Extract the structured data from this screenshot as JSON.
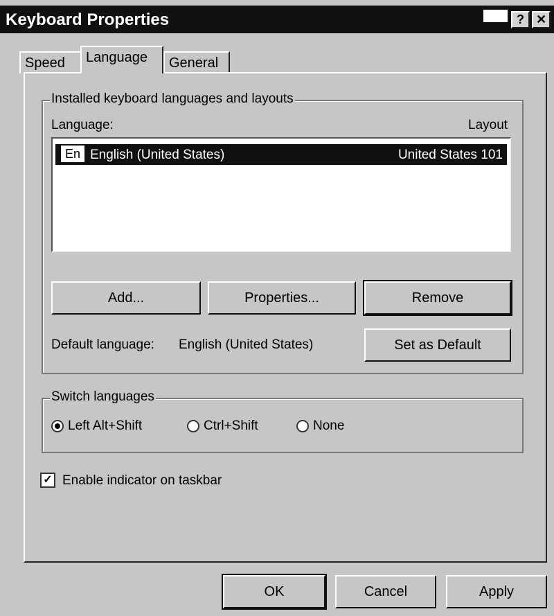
{
  "window": {
    "title": "Keyboard Properties"
  },
  "titlebar": {
    "help_label": "?",
    "close_label": "✕"
  },
  "tabs": [
    {
      "label": "Speed"
    },
    {
      "label": "Language"
    },
    {
      "label": "General"
    }
  ],
  "installed": {
    "group_title": "Installed keyboard languages and layouts",
    "col_language": "Language:",
    "col_layout": "Layout",
    "rows": [
      {
        "badge": "En",
        "language": "English (United States)",
        "layout": "United States 101"
      }
    ]
  },
  "buttons": {
    "add": "Add...",
    "properties": "Properties...",
    "remove": "Remove",
    "set_default": "Set as Default"
  },
  "default_language": {
    "label": "Default language:",
    "value": "English (United States)"
  },
  "switch": {
    "group_title": "Switch languages",
    "options": [
      {
        "label": "Left Alt+Shift",
        "selected": true
      },
      {
        "label": "Ctrl+Shift",
        "selected": false
      },
      {
        "label": "None",
        "selected": false
      }
    ]
  },
  "indicator": {
    "label": "Enable indicator on taskbar",
    "checked": true,
    "check_glyph": "✓"
  },
  "footer": {
    "ok": "OK",
    "cancel": "Cancel",
    "apply": "Apply"
  }
}
